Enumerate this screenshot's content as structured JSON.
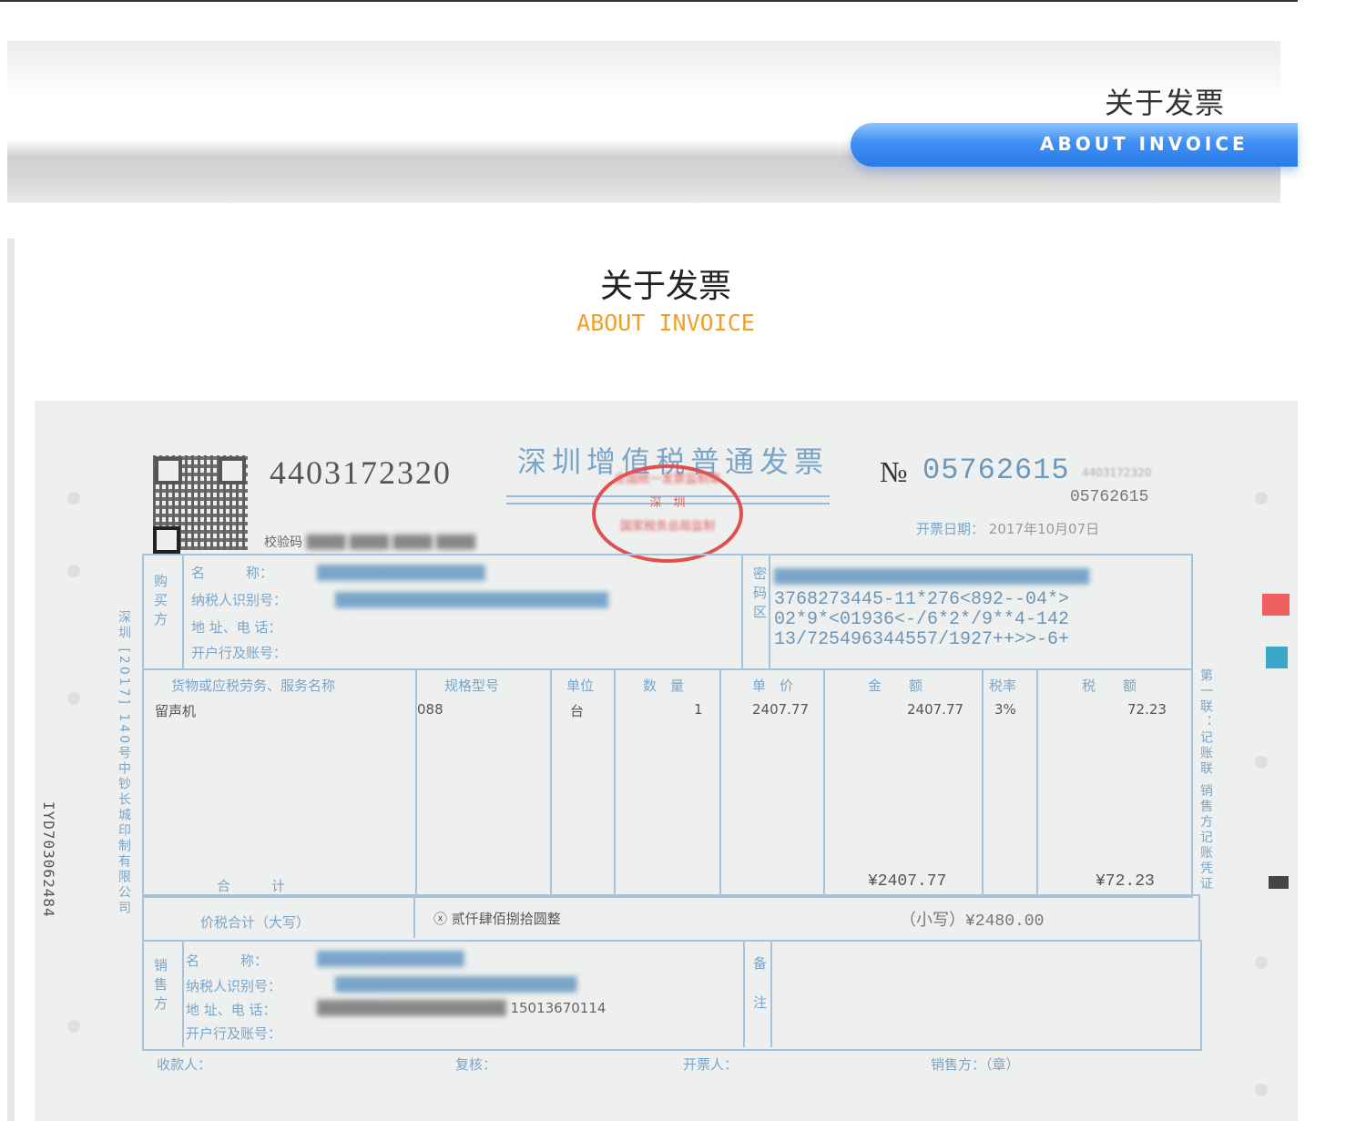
{
  "header": {
    "title": "关于发票",
    "pill_text": "ABOUT INVOICE"
  },
  "section": {
    "title": "关于发票",
    "subtitle": "ABOUT INVOICE"
  },
  "invoice": {
    "code": "4403172320",
    "title": "深圳增值税普通发票",
    "no_label": "№",
    "number": "05762615",
    "number_small": "05762615",
    "verify_label": "校验码",
    "date_label": "开票日期：",
    "date_value": "2017年10月07日",
    "buyer_group": "购买方",
    "cipher_group": "密码区",
    "buyer_fields": [
      "名　　　称：",
      "纳税人识别号：",
      "地 址、电 话：",
      "开户行及账号："
    ],
    "cipher_lines": [
      "3768273445-11*276<892--04*>",
      "02*9*<01936<-/6*2*/9**4-142",
      "13/725496344557/1927++>>-6+"
    ],
    "columns": [
      "货物或应税劳务、服务名称",
      "规格型号",
      "单位",
      "数　量",
      "单　价",
      "金　　额",
      "税率",
      "税　　额"
    ],
    "item": {
      "name": "留声机",
      "model": "088",
      "unit": "台",
      "qty": "1",
      "price": "2407.77",
      "amount": "2407.77",
      "rate": "3%",
      "tax": "72.23"
    },
    "total_label": "合　　　计",
    "total_amount": "¥2407.77",
    "total_tax": "¥72.23",
    "grand_label": "价税合计（大写）",
    "grand_words": "ⓧ 贰仟肆佰捌拾圆整",
    "grand_small": "（小写）¥2480.00",
    "seller_group": "销售方",
    "seller_fields": [
      "名　　　称：",
      "纳税人识别号：",
      "地 址、电 话：",
      "开户行及账号："
    ],
    "seller_phone": "15013670114",
    "remark_label": "备注",
    "footer": [
      "收款人：",
      "复核：",
      "开票人：",
      "销售方：（章）"
    ],
    "left_print": "深圳 [2017] 140号中钞长城印制有限公司",
    "right_print": "第一联：记账联 销售方记账凭证",
    "serial": "IYD703062484"
  },
  "colors": {
    "accent_blue": "#3f8ff2",
    "subtitle_orange": "#f0a028",
    "stamp_red": "#e05050"
  }
}
